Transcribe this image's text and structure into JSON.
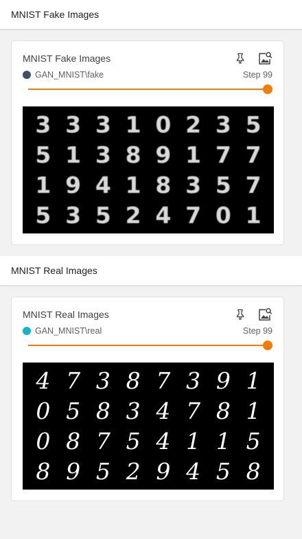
{
  "sections": [
    {
      "header": "MNIST Fake Images",
      "card": {
        "title": "MNIST Fake Images",
        "run": "GAN_MNIST\\fake",
        "run_color": "#425066",
        "step_label": "Step 99",
        "slider_fraction": 1.0,
        "digits": [
          "3",
          "3",
          "3",
          "1",
          "0",
          "2",
          "3",
          "5",
          "5",
          "1",
          "3",
          "8",
          "9",
          "1",
          "7",
          "7",
          "1",
          "9",
          "4",
          "1",
          "8",
          "3",
          "5",
          "7",
          "5",
          "3",
          "5",
          "2",
          "4",
          "7",
          "0",
          "1"
        ]
      }
    },
    {
      "header": "MNIST Real Images",
      "card": {
        "title": "MNIST Real Images",
        "run": "GAN_MNIST\\real",
        "run_color": "#12b5cb",
        "step_label": "Step 99",
        "slider_fraction": 1.0,
        "digits": [
          "4",
          "7",
          "3",
          "8",
          "7",
          "3",
          "9",
          "1",
          "0",
          "5",
          "8",
          "3",
          "4",
          "7",
          "8",
          "1",
          "0",
          "8",
          "7",
          "5",
          "4",
          "1",
          "1",
          "5",
          "8",
          "9",
          "5",
          "2",
          "9",
          "4",
          "5",
          "8"
        ]
      }
    }
  ],
  "icons": {
    "pin": "pin-icon",
    "image_search": "image-search-icon"
  },
  "accent_color": "#f57c00"
}
